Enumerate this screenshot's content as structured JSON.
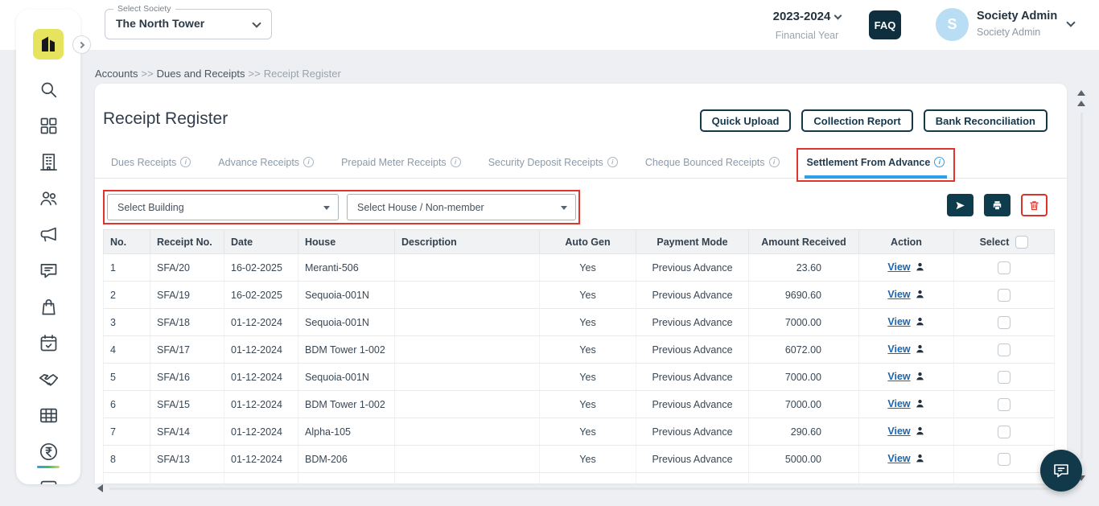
{
  "header": {
    "society": {
      "label": "Select Society",
      "value": "The North Tower"
    },
    "financial_year": {
      "value": "2023-2024",
      "label": "Financial Year"
    },
    "faq_label": "FAQ",
    "user": {
      "initial": "S",
      "name": "Society Admin",
      "role": "Society Admin"
    }
  },
  "breadcrumb": {
    "separator": ">>",
    "items": [
      "Accounts",
      "Dues and Receipts",
      "Receipt Register"
    ]
  },
  "sidebar": {
    "icons": [
      "app-logo",
      "search",
      "dashboard-grid",
      "building",
      "people",
      "megaphone",
      "chat",
      "bag",
      "calendar",
      "handshake",
      "table",
      "rupee",
      "window"
    ],
    "active_icon": "rupee"
  },
  "page": {
    "title": "Receipt Register",
    "header_buttons": [
      "Quick Upload",
      "Collection Report",
      "Bank Reconciliation"
    ]
  },
  "tabs": [
    {
      "label": "Dues Receipts",
      "active": false
    },
    {
      "label": "Advance Receipts",
      "active": false
    },
    {
      "label": "Prepaid Meter Receipts",
      "active": false
    },
    {
      "label": "Security Deposit Receipts",
      "active": false
    },
    {
      "label": "Cheque Bounced Receipts",
      "active": false
    },
    {
      "label": "Settlement From Advance",
      "active": true
    }
  ],
  "filters": {
    "building": "Select Building",
    "house": "Select House / Non-member"
  },
  "table": {
    "columns": [
      "No.",
      "Receipt No.",
      "Date",
      "House",
      "Description",
      "Auto Gen",
      "Payment Mode",
      "Amount Received",
      "Action",
      "Select"
    ],
    "action_label": "View",
    "rows": [
      {
        "no": "1",
        "receipt_no": "SFA/20",
        "date": "16-02-2025",
        "house": "Meranti-506",
        "description": "",
        "auto_gen": "Yes",
        "payment_mode": "Previous Advance",
        "amount_received": "23.60"
      },
      {
        "no": "2",
        "receipt_no": "SFA/19",
        "date": "16-02-2025",
        "house": "Sequoia-001N",
        "description": "",
        "auto_gen": "Yes",
        "payment_mode": "Previous Advance",
        "amount_received": "9690.60"
      },
      {
        "no": "3",
        "receipt_no": "SFA/18",
        "date": "01-12-2024",
        "house": "Sequoia-001N",
        "description": "",
        "auto_gen": "Yes",
        "payment_mode": "Previous Advance",
        "amount_received": "7000.00"
      },
      {
        "no": "4",
        "receipt_no": "SFA/17",
        "date": "01-12-2024",
        "house": "BDM Tower 1-002",
        "description": "",
        "auto_gen": "Yes",
        "payment_mode": "Previous Advance",
        "amount_received": "6072.00"
      },
      {
        "no": "5",
        "receipt_no": "SFA/16",
        "date": "01-12-2024",
        "house": "Sequoia-001N",
        "description": "",
        "auto_gen": "Yes",
        "payment_mode": "Previous Advance",
        "amount_received": "7000.00"
      },
      {
        "no": "6",
        "receipt_no": "SFA/15",
        "date": "01-12-2024",
        "house": "BDM Tower 1-002",
        "description": "",
        "auto_gen": "Yes",
        "payment_mode": "Previous Advance",
        "amount_received": "7000.00"
      },
      {
        "no": "7",
        "receipt_no": "SFA/14",
        "date": "01-12-2024",
        "house": "Alpha-105",
        "description": "",
        "auto_gen": "Yes",
        "payment_mode": "Previous Advance",
        "amount_received": "290.60"
      },
      {
        "no": "8",
        "receipt_no": "SFA/13",
        "date": "01-12-2024",
        "house": "BDM-206",
        "description": "",
        "auto_gen": "Yes",
        "payment_mode": "Previous Advance",
        "amount_received": "5000.00"
      }
    ]
  },
  "colors": {
    "accent_red": "#e0352c",
    "dark_navy": "#0e3c4d",
    "tab_underline_blue": "#2f9fe8",
    "link_blue": "#1b66ad",
    "avatar_blue": "#b9ddf3"
  }
}
